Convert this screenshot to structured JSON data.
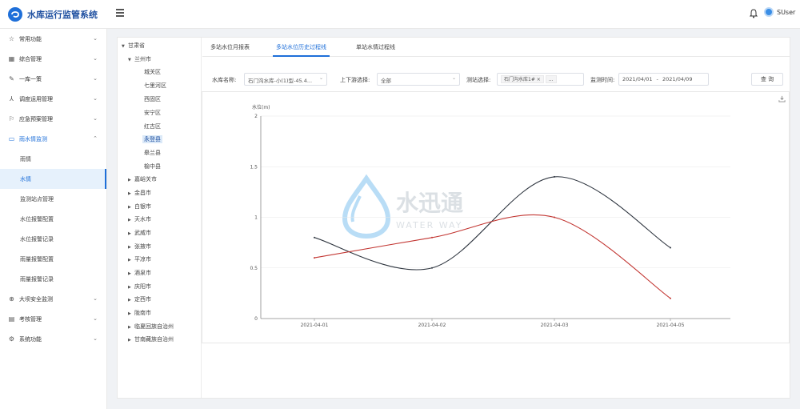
{
  "app": {
    "title": "水库运行监管系统",
    "user": "SUser"
  },
  "sidebar": {
    "items": [
      {
        "label": "常用功能",
        "icon": "star-icon"
      },
      {
        "label": "综合管理",
        "icon": "grid-icon"
      },
      {
        "label": "一库一策",
        "icon": "edit-icon"
      },
      {
        "label": "调度运用管理",
        "icon": "network-icon"
      },
      {
        "label": "应急预案管理",
        "icon": "flag-icon"
      },
      {
        "label": "雨水情监测",
        "icon": "monitor-icon"
      }
    ],
    "sub_items": [
      "雨情",
      "水情",
      "监测站点管理",
      "水位报警配置",
      "水位报警记录",
      "雨量报警配置",
      "雨量报警记录"
    ],
    "bottom_items": [
      {
        "label": "大坝安全监测",
        "icon": "dam-icon"
      },
      {
        "label": "考核管理",
        "icon": "list-icon"
      },
      {
        "label": "系统功能",
        "icon": "gear-icon"
      }
    ]
  },
  "tree": {
    "root": "甘肃省",
    "city": "兰州市",
    "districts": [
      "城关区",
      "七里河区",
      "西固区",
      "安宁区",
      "红古区",
      "永登县",
      "皋兰县",
      "榆中县"
    ],
    "others": [
      "嘉峪关市",
      "金昌市",
      "白银市",
      "天水市",
      "武威市",
      "张掖市",
      "平凉市",
      "酒泉市",
      "庆阳市",
      "定西市",
      "陇南市",
      "临夏回族自治州",
      "甘南藏族自治州"
    ]
  },
  "tabs": [
    "多站水位月报表",
    "多站水位历史过程线",
    "单站水情过程线"
  ],
  "filters": {
    "reservoir_label": "水库名称:",
    "reservoir_value": "石门沟水库-小(1)型-45.4...",
    "updown_label": "上下游选择:",
    "updown_value": "全部",
    "station_label": "测站选择:",
    "station_tag": "石门沟水库1#",
    "station_close": "×",
    "station_more": "...",
    "time_label": "监测时间:",
    "time_start": "2021/04/01",
    "time_sep": "-",
    "time_end": "2021/04/09",
    "query_label": "查 询"
  },
  "watermark": {
    "cn": "水迅通",
    "en": "WATER WAY"
  },
  "chart_data": {
    "type": "line",
    "ylabel": "水位(m)",
    "categories": [
      "2021-04-01",
      "2021-04-02",
      "2021-04-03",
      "2021-04-05"
    ],
    "ylim": [
      0,
      2
    ],
    "yticks": [
      "0",
      "0.5",
      "1",
      "1.5",
      "2"
    ],
    "series": [
      {
        "values": [
          0.8,
          0.5,
          1.4,
          0.7
        ],
        "color": "#2f3640"
      },
      {
        "values": [
          0.6,
          0.8,
          1.0,
          0.2
        ],
        "color": "#c23531"
      }
    ]
  }
}
